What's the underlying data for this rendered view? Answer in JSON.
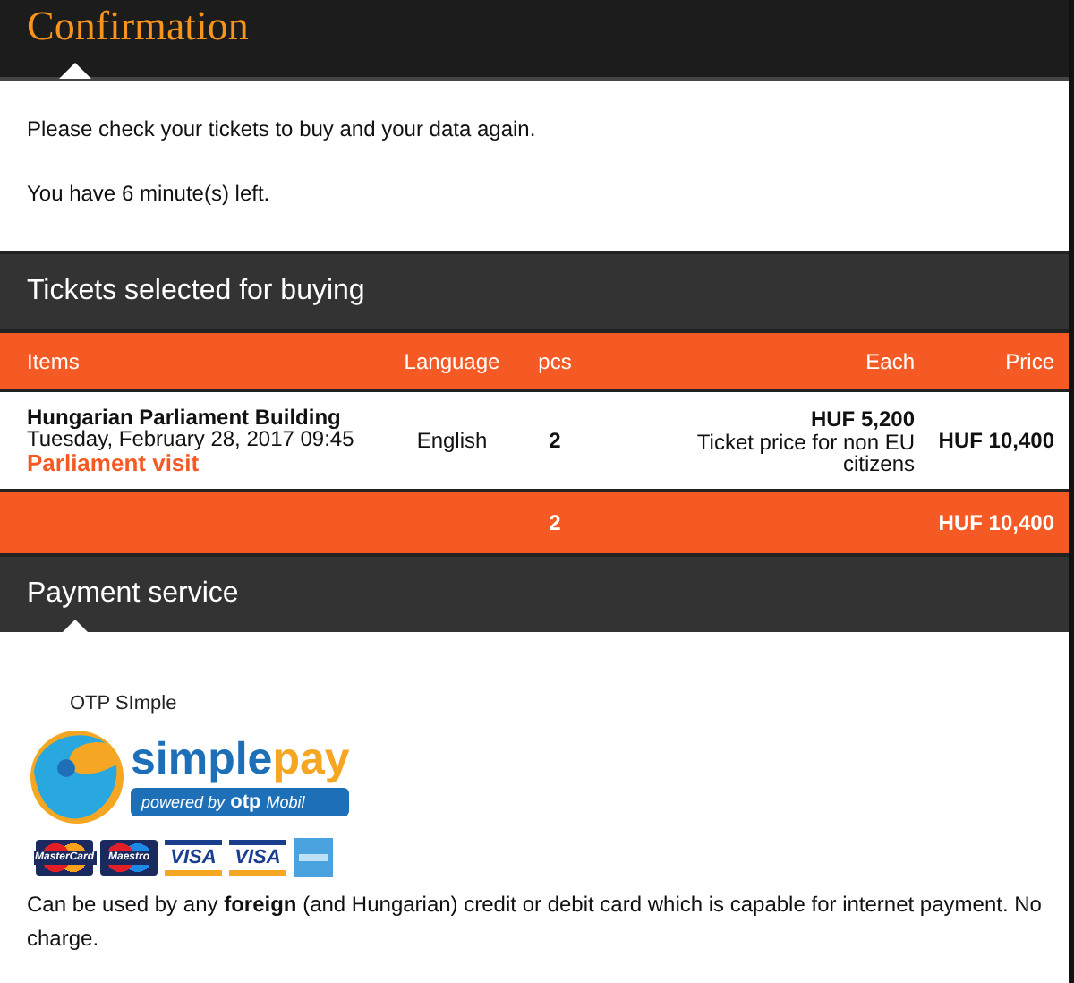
{
  "header": {
    "title": "Confirmation"
  },
  "intro": [
    "Please check your tickets to buy and your data again.",
    "You have 6 minute(s) left."
  ],
  "tickets": {
    "title": "Tickets selected for buying",
    "columns": [
      "Items",
      "Language",
      "pcs",
      "Each",
      "Price"
    ],
    "rows": [
      {
        "name": "Hungarian Parliament Building",
        "date": "Tuesday, February 28, 2017 09:45",
        "visit": "Parliament visit",
        "language": "English",
        "pcs": "2",
        "each": "HUF 5,200",
        "each_note": "Ticket price for non EU citizens",
        "price": "HUF 10,400"
      }
    ],
    "total": {
      "pcs": "2",
      "price": "HUF 10,400"
    }
  },
  "payment": {
    "title": "Payment service",
    "provider": "OTP SImple",
    "logo": {
      "simple": "simple",
      "pay": "pay",
      "powered": "powered by",
      "otp": "otp",
      "mobil": "Mobil"
    },
    "cards": [
      {
        "kind": "mastercard",
        "label": "MasterCard"
      },
      {
        "kind": "maestro",
        "label": "Maestro"
      },
      {
        "kind": "visa",
        "label": "VISA"
      },
      {
        "kind": "visa",
        "label": "VISA"
      },
      {
        "kind": "amex"
      }
    ],
    "note": "Can be used by any **foreign** (and Hungarian) credit or debit card which is capable for internet payment. No charge."
  }
}
